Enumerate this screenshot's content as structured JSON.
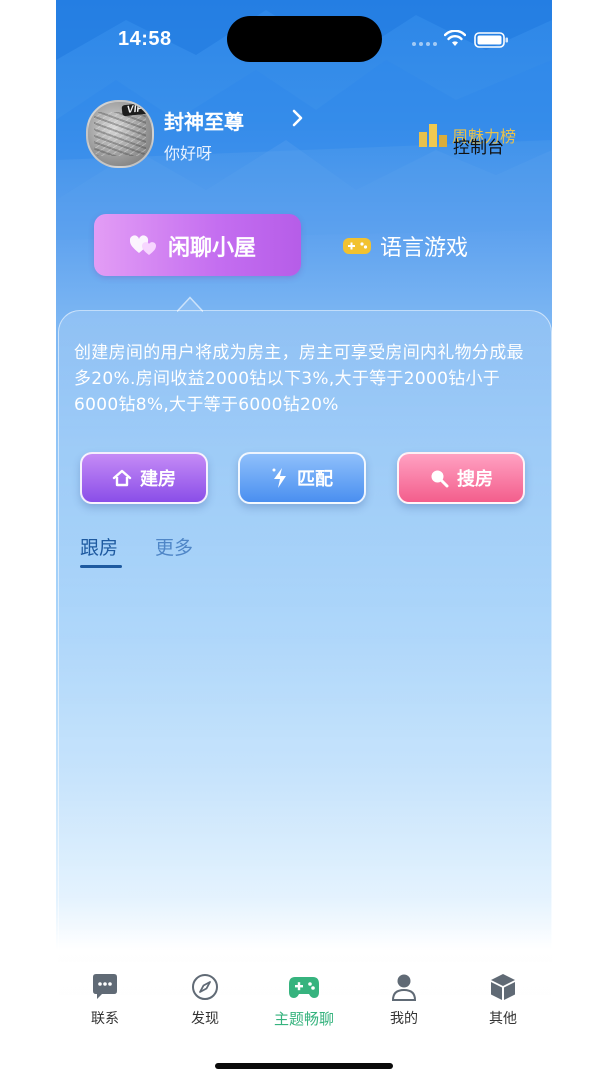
{
  "status_bar": {
    "time": "14:58"
  },
  "profile": {
    "vip_badge": "VIP",
    "nickname": "封神至尊",
    "greeting": "你好呀",
    "ranking_label": "周魅力榜",
    "console_label": "控制台"
  },
  "room_tabs": [
    {
      "label": "闲聊小屋",
      "icon": "hearts-icon",
      "selected": true
    },
    {
      "label": "语言游戏",
      "icon": "gamepad-icon",
      "selected": false
    }
  ],
  "description": "创建房间的用户将成为房主，房主可享受房间内礼物分成最多20%.房间收益2000钻以下3%,大于等于2000钻小于6000钻8%,大于等于6000钻20%",
  "actions": {
    "build": {
      "label": "建房",
      "icon": "house-icon"
    },
    "match": {
      "label": "匹配",
      "icon": "lightning-icon"
    },
    "search": {
      "label": "搜房",
      "icon": "magnifier-icon"
    }
  },
  "sub_tabs": [
    {
      "label": "跟房",
      "selected": true
    },
    {
      "label": "更多",
      "selected": false
    }
  ],
  "bottom_nav": [
    {
      "label": "联系",
      "icon": "chat-bubble-icon",
      "selected": false
    },
    {
      "label": "发现",
      "icon": "compass-icon",
      "selected": false
    },
    {
      "label": "主题畅聊",
      "icon": "gamepad-icon",
      "selected": true
    },
    {
      "label": "我的",
      "icon": "person-icon",
      "selected": false
    },
    {
      "label": "其他",
      "icon": "box-icon",
      "selected": false
    }
  ],
  "colors": {
    "accent_green": "#36b37e",
    "rank_gold": "#e8c14c",
    "chat_tab_purple": "#c46ef0"
  }
}
